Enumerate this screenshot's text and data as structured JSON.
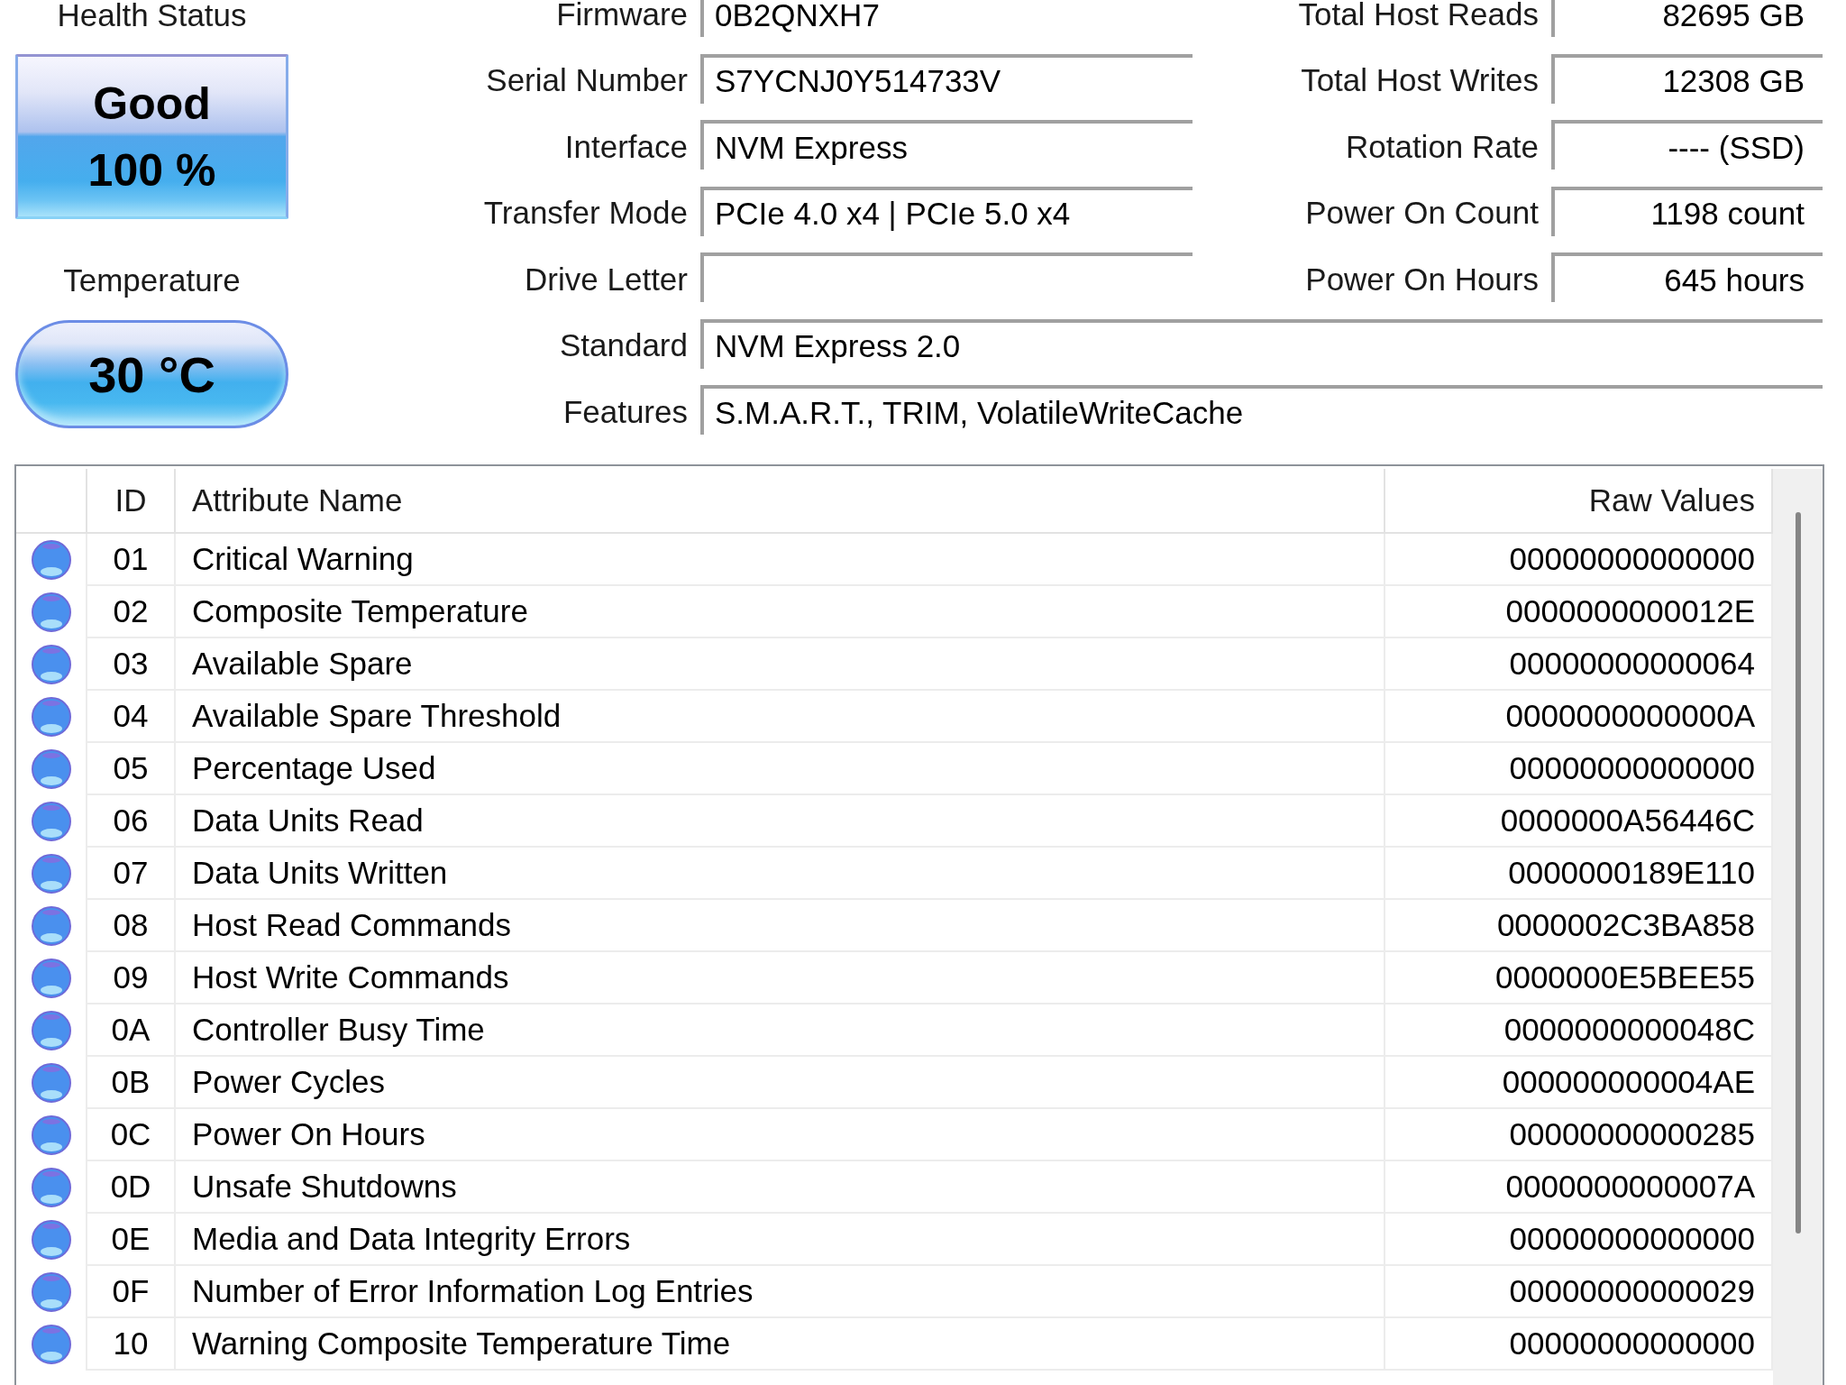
{
  "health_status": {
    "label": "Health Status",
    "status": "Good",
    "percent": "100 %"
  },
  "temperature": {
    "label": "Temperature",
    "value": "30 °C"
  },
  "drive_info": [
    {
      "label": "Firmware",
      "value": "0B2QNXH7"
    },
    {
      "label": "Serial Number",
      "value": "S7YCNJ0Y514733V"
    },
    {
      "label": "Interface",
      "value": "NVM Express"
    },
    {
      "label": "Transfer Mode",
      "value": "PCIe 4.0 x4 | PCIe 5.0 x4"
    },
    {
      "label": "Drive Letter"
    },
    {
      "label": "Standard",
      "value": "NVM Express 2.0"
    },
    {
      "label": "Features",
      "value": "S.M.A.R.T., TRIM, VolatileWriteCache"
    }
  ],
  "usage_info": [
    {
      "label": "Total Host Reads",
      "value": "82695 GB"
    },
    {
      "label": "Total Host Writes",
      "value": "12308 GB"
    },
    {
      "label": "Rotation Rate",
      "value": "---- (SSD)"
    },
    {
      "label": "Power On Count",
      "value": "1198 count"
    },
    {
      "label": "Power On Hours",
      "value": "645 hours"
    }
  ],
  "attributes_table": {
    "columns": [
      "ID",
      "Attribute Name",
      "Raw Values"
    ],
    "rows": [
      {
        "color": "#4a90ee",
        "id": "01",
        "name": "Critical Warning",
        "raw_value": "00000000000000"
      },
      {
        "color": "#4a90ee",
        "id": "02",
        "name": "Composite Temperature",
        "raw_value": "0000000000012E"
      },
      {
        "color": "#4a90ee",
        "id": "03",
        "name": "Available Spare",
        "raw_value": "00000000000064"
      },
      {
        "color": "#4a90ee",
        "id": "04",
        "name": "Available Spare Threshold",
        "raw_value": "0000000000000A"
      },
      {
        "color": "#4a90ee",
        "id": "05",
        "name": "Percentage Used",
        "raw_value": "00000000000000"
      },
      {
        "color": "#4a90ee",
        "id": "06",
        "name": "Data Units Read",
        "raw_value": "0000000A56446C"
      },
      {
        "color": "#4a90ee",
        "id": "07",
        "name": "Data Units Written",
        "raw_value": "0000000189E110"
      },
      {
        "color": "#4a90ee",
        "id": "08",
        "name": "Host Read Commands",
        "raw_value": "0000002C3BA858"
      },
      {
        "color": "#4a90ee",
        "id": "09",
        "name": "Host Write Commands",
        "raw_value": "0000000E5BEE55"
      },
      {
        "color": "#4a90ee",
        "id": "0A",
        "name": "Controller Busy Time",
        "raw_value": "0000000000048C"
      },
      {
        "color": "#4a90ee",
        "id": "0B",
        "name": "Power Cycles",
        "raw_value": "000000000004AE"
      },
      {
        "color": "#4a90ee",
        "id": "0C",
        "name": "Power On Hours",
        "raw_value": "00000000000285"
      },
      {
        "color": "#4a90ee",
        "id": "0D",
        "name": "Unsafe Shutdowns",
        "raw_value": "0000000000007A"
      },
      {
        "color": "#4a90ee",
        "id": "0E",
        "name": "Media and Data Integrity Errors",
        "raw_value": "00000000000000"
      },
      {
        "color": "#4a90ee",
        "id": "0F",
        "name": "Number of Error Information Log Entries",
        "raw_value": "00000000000029"
      },
      {
        "color": "#4a90ee",
        "id": "10",
        "name": "Warning Composite Temperature Time",
        "raw_value": "00000000000000"
      }
    ]
  }
}
